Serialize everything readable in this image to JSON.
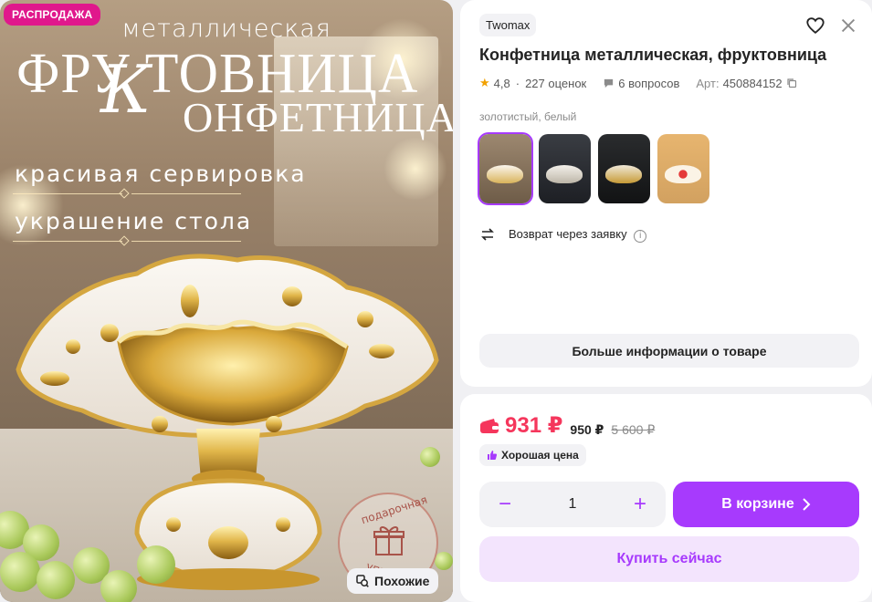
{
  "image": {
    "sale_badge": "РАСПРОДАЖА",
    "headline_small": "металлическая",
    "headline_big_1": "ФРУ ТОВНИЦА",
    "headline_k": "К",
    "headline_big_2": "ОНФЕТНИЦА",
    "line_1": "красивая сервировка",
    "line_2": "украшение стола",
    "gift_top": "подарочная",
    "gift_bottom": "упаковка",
    "similar_label": "Похожие"
  },
  "product": {
    "brand": "Twomax",
    "title": "Конфетница металлическая, фруктовница",
    "rating": "4,8",
    "reviews": "227 оценок",
    "questions": "6 вопросов",
    "article_label": "Арт:",
    "article": "450884152",
    "color_label": "золотистый, белый",
    "thumbnails": [
      "variant-1",
      "variant-2",
      "variant-3",
      "variant-4"
    ],
    "return_text": "Возврат через заявку",
    "more_info": "Больше информации о товаре"
  },
  "purchase": {
    "price": "931 ₽",
    "price_old": "950 ₽",
    "price_original": "5 600 ₽",
    "good_price": "Хорошая цена",
    "quantity": "1",
    "minus": "−",
    "plus": "+",
    "cart_label": "В корзине",
    "buy_now": "Купить сейчас"
  },
  "colors": {
    "accent": "#a73afd",
    "price": "#f5365c",
    "sale_badge": "#e0188c"
  }
}
